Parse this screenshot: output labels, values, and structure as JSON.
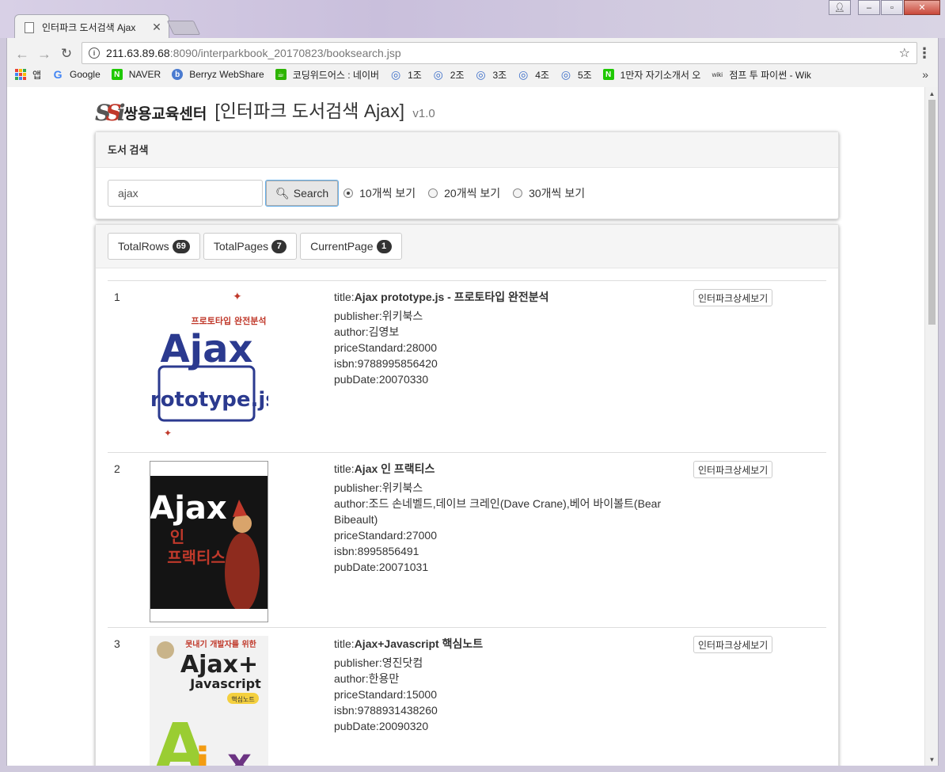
{
  "browser": {
    "tab_title": "인터파크 도서검색 Ajax",
    "url_host": "211.63.89.68",
    "url_path": ":8090/interparkbook_20170823/booksearch.jsp",
    "bookmarks": [
      {
        "label": "앱",
        "icon": "apps-icon"
      },
      {
        "label": "Google",
        "icon": "google-icon"
      },
      {
        "label": "NAVER",
        "icon": "naver-icon"
      },
      {
        "label": "Berryz WebShare",
        "icon": "berryz-icon"
      },
      {
        "label": "코딩위드어스 : 네이버",
        "icon": "cafe-icon"
      },
      {
        "label": "1조",
        "icon": "circle-icon"
      },
      {
        "label": "2조",
        "icon": "circle-icon"
      },
      {
        "label": "3조",
        "icon": "circle-icon"
      },
      {
        "label": "4조",
        "icon": "circle-icon"
      },
      {
        "label": "5조",
        "icon": "circle-icon"
      },
      {
        "label": "1만자 자기소개서 오",
        "icon": "naver-icon"
      },
      {
        "label": "점프 투 파이썬 - Wik",
        "icon": "wikidocs-icon"
      }
    ],
    "bookmarks_more": "»"
  },
  "header": {
    "logo_text": "쌍용교육센터",
    "title": "[인터파크 도서검색 Ajax]",
    "version": "v1.0"
  },
  "search_panel": {
    "heading": "도서 검색",
    "query": "ajax",
    "button_label": "Search",
    "page_size_options": [
      "10개씩 보기",
      "20개씩 보기",
      "30개씩 보기"
    ],
    "selected_option": "10개씩 보기"
  },
  "stats": {
    "total_rows_label": "TotalRows",
    "total_rows": "69",
    "total_pages_label": "TotalPages",
    "total_pages": "7",
    "current_page_label": "CurrentPage",
    "current_page": "1"
  },
  "detail_button_label": "인터파크상세보기",
  "books": [
    {
      "num": "1",
      "title_prefix": "title:",
      "title": "Ajax prototype.js - 프로토타입 완전분석",
      "publisher": "publisher:위키북스",
      "author": "author:김영보",
      "price": "priceStandard:28000",
      "isbn": "isbn:9788995856420",
      "pubdate": "pubDate:20070330",
      "cover": {
        "top": "프로토타입 완전분석",
        "main": "Ajax",
        "sub": "prototype.js",
        "bg": "#ffffff",
        "accent": "#2b3a8f"
      }
    },
    {
      "num": "2",
      "title_prefix": "title:",
      "title": "Ajax 인 프랙티스",
      "publisher": "publisher:위키북스",
      "author": "author:조드 손네벨드,데이브 크레인(Dave Crane),베어 바이볼트(Bear Bibeault)",
      "price": "priceStandard:27000",
      "isbn": "isbn:8995856491",
      "pubdate": "pubDate:20071031",
      "cover": {
        "main": "Ajax",
        "sub1": "인",
        "sub2": "프랙티스",
        "bg": "#141414",
        "accent": "#c0392b"
      }
    },
    {
      "num": "3",
      "title_prefix": "title:",
      "title": "Ajax+Javascript 핵심노트",
      "publisher": "publisher:영진닷컴",
      "author": "author:한용만",
      "price": "priceStandard:15000",
      "isbn": "isbn:9788931438260",
      "pubdate": "pubDate:20090320",
      "cover": {
        "top": "못내기 개발자를 위한",
        "main": "Ajax+",
        "sub": "Javascript",
        "badge": "핵심노트",
        "bg": "#f2f2f2",
        "accent": "#9acd32"
      }
    }
  ]
}
